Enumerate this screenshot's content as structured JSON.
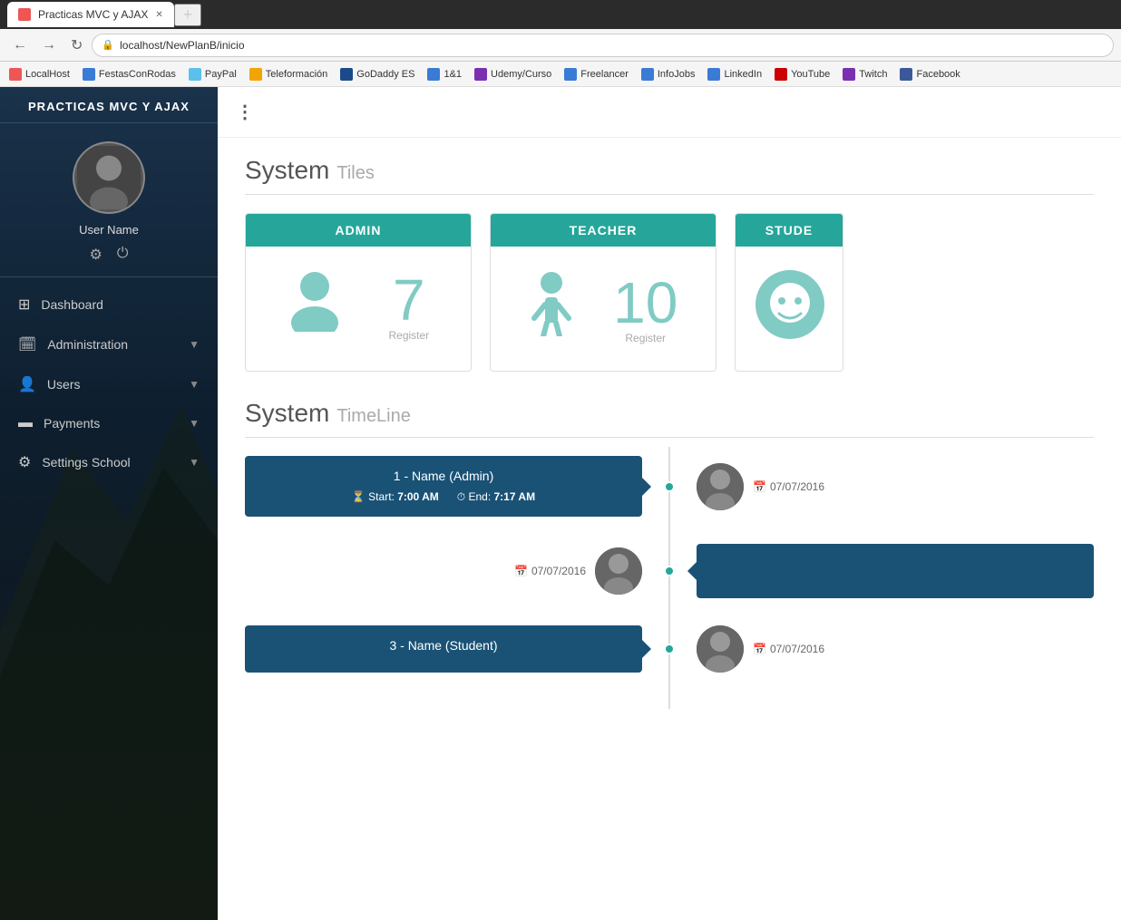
{
  "browser": {
    "tab_title": "Practicas MVC y AJAX",
    "url": "localhost/NewPlanB/inicio",
    "new_tab_label": "+"
  },
  "bookmarks": [
    {
      "id": "localhost",
      "label": "LocalHost",
      "color": "bk-orange"
    },
    {
      "id": "festas",
      "label": "FestasConRodas",
      "color": "bk-blue"
    },
    {
      "id": "paypal",
      "label": "PayPal",
      "color": "bk-lblue"
    },
    {
      "id": "teleformacion",
      "label": "Teleformación",
      "color": "bk-gold"
    },
    {
      "id": "godaddy",
      "label": "GoDaddy ES",
      "color": "bk-darkblue"
    },
    {
      "id": "1and1",
      "label": "1&1",
      "color": "bk-blue"
    },
    {
      "id": "udemy",
      "label": "Udemy/Curso",
      "color": "bk-purple"
    },
    {
      "id": "freelancer",
      "label": "Freelancer",
      "color": "bk-blue"
    },
    {
      "id": "infojobs",
      "label": "InfoJobs",
      "color": "bk-blue"
    },
    {
      "id": "linkedin",
      "label": "LinkedIn",
      "color": "bk-blue"
    },
    {
      "id": "youtube",
      "label": "YouTube",
      "color": "bk-red"
    },
    {
      "id": "twitch",
      "label": "Twitch",
      "color": "bk-purple"
    },
    {
      "id": "facebook",
      "label": "Facebook",
      "color": "bk-fb"
    }
  ],
  "sidebar": {
    "app_title": "PRACTICAS MVC Y AJAX",
    "user_name": "User Name",
    "nav_items": [
      {
        "id": "dashboard",
        "icon": "⊞",
        "label": "Dashboard",
        "has_chevron": false
      },
      {
        "id": "administration",
        "icon": "🗓",
        "label": "Administration",
        "has_chevron": true
      },
      {
        "id": "users",
        "icon": "👤",
        "label": "Users",
        "has_chevron": true
      },
      {
        "id": "payments",
        "icon": "💳",
        "label": "Payments",
        "has_chevron": true
      },
      {
        "id": "settings-school",
        "icon": "⚙",
        "label": "Settings School",
        "has_chevron": true
      }
    ]
  },
  "topbar": {
    "menu_dots": "⋮"
  },
  "system_tiles": {
    "section_title": "System",
    "section_subtitle": "Tiles",
    "tiles": [
      {
        "id": "admin",
        "header": "ADMIN",
        "count": "7",
        "label": "Register",
        "icon_type": "person"
      },
      {
        "id": "teacher",
        "header": "TEACHER",
        "count": "10",
        "label": "Register",
        "icon_type": "teacher"
      },
      {
        "id": "student",
        "header": "STUDE",
        "count": "",
        "label": "",
        "icon_type": "face"
      }
    ]
  },
  "system_timeline": {
    "section_title": "System",
    "section_subtitle": "TimeLine",
    "items": [
      {
        "id": "tl-1",
        "side": "left",
        "title": "1 - Name (Admin)",
        "start_time": "7:00 AM",
        "end_time": "7:17 AM",
        "date": "07/07/2016",
        "has_avatar": true
      },
      {
        "id": "tl-2",
        "side": "right",
        "title": "",
        "start_time": "",
        "end_time": "",
        "date": "07/07/2016",
        "has_avatar": true
      },
      {
        "id": "tl-3",
        "side": "left",
        "title": "3 - Name (Student)",
        "start_time": "",
        "end_time": "",
        "date": "07/07/2016",
        "has_avatar": true
      }
    ]
  }
}
